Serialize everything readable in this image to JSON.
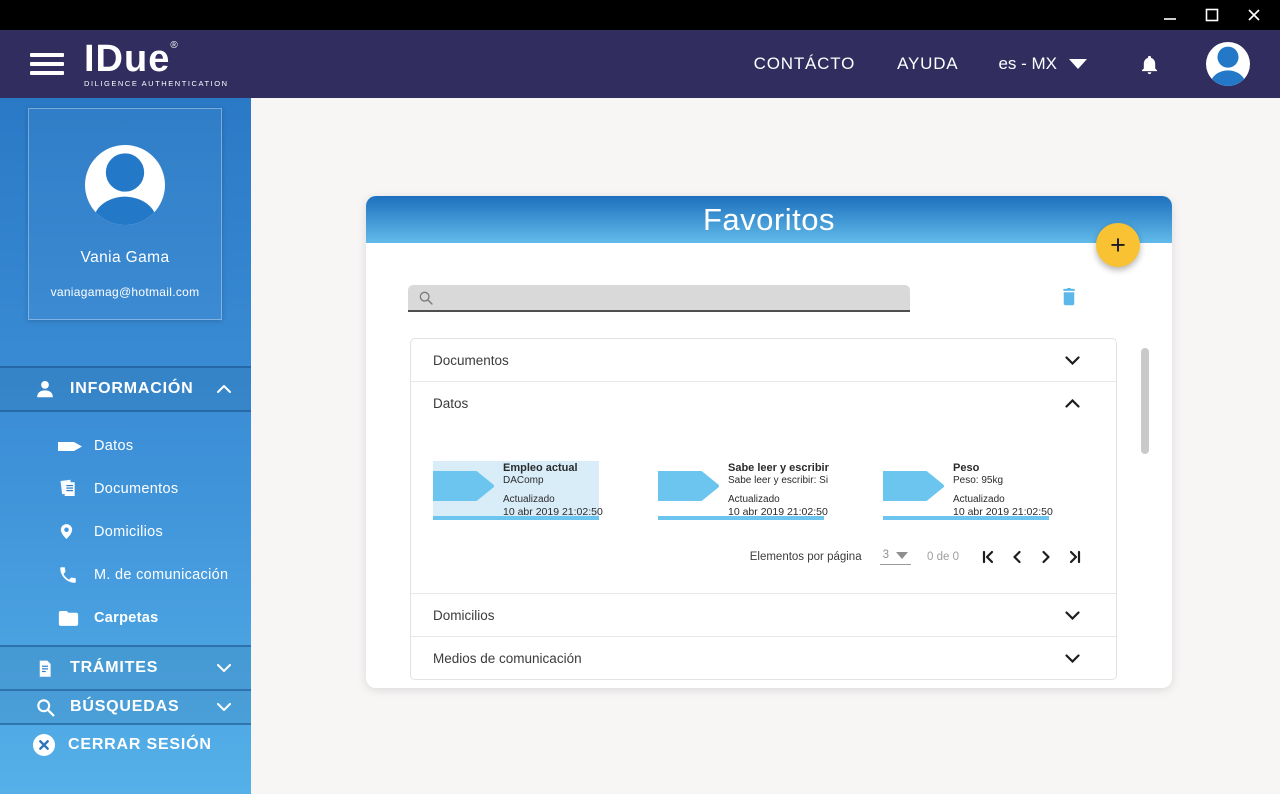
{
  "header": {
    "brand": {
      "name": "IDue",
      "registered": "®",
      "tagline": "DILIGENCE AUTHENTICATION"
    },
    "links": {
      "contact": "CONTÁCTO",
      "help": "AYUDA"
    },
    "language": "es - MX"
  },
  "sidebar": {
    "profile": {
      "name": "Vania Gama",
      "email": "vaniagamag@hotmail.com"
    },
    "info_label": "INFORMACIÓN",
    "info_items": [
      {
        "label": "Datos"
      },
      {
        "label": "Documentos"
      },
      {
        "label": "Domicilios"
      },
      {
        "label": "M. de comunicación"
      },
      {
        "label": "Carpetas"
      }
    ],
    "tramites_label": "TRÁMITES",
    "busquedas_label": "BÚSQUEDAS",
    "logout_label": "CERRAR SESIÓN"
  },
  "main": {
    "title": "Favoritos",
    "add_label": "+",
    "accordion": {
      "documentos": "Documentos",
      "datos": "Datos",
      "domicilios": "Domicilios",
      "medios": "Medios de comunicación"
    },
    "cards": [
      {
        "title": "Empleo actual",
        "subtitle": "DAComp",
        "updated_label": "Actualizado",
        "updated_at": "10 abr 2019 21:02:50"
      },
      {
        "title": "Sabe leer y escribir",
        "subtitle": "Sabe leer y escribir: Si",
        "updated_label": "Actualizado",
        "updated_at": "10 abr 2019 21:02:50"
      },
      {
        "title": "Peso",
        "subtitle": "Peso: 95kg",
        "updated_label": "Actualizado",
        "updated_at": "10 abr 2019 21:02:50"
      }
    ],
    "pagination": {
      "items_per_page_label": "Elementos por página",
      "per_page": "3",
      "range": "0 de 0"
    }
  },
  "colors": {
    "header_bg": "#312d5e",
    "sidebar_top": "#2a79c6",
    "sidebar_bottom": "#55b0e8",
    "banner_top": "#1d70bd",
    "banner_bottom": "#62bbea",
    "accent_yellow": "#f9c233",
    "accent_blue": "#5cb8e8",
    "card_highlight_bg": "#d9edf9",
    "card_border": "#6cc5ef"
  }
}
